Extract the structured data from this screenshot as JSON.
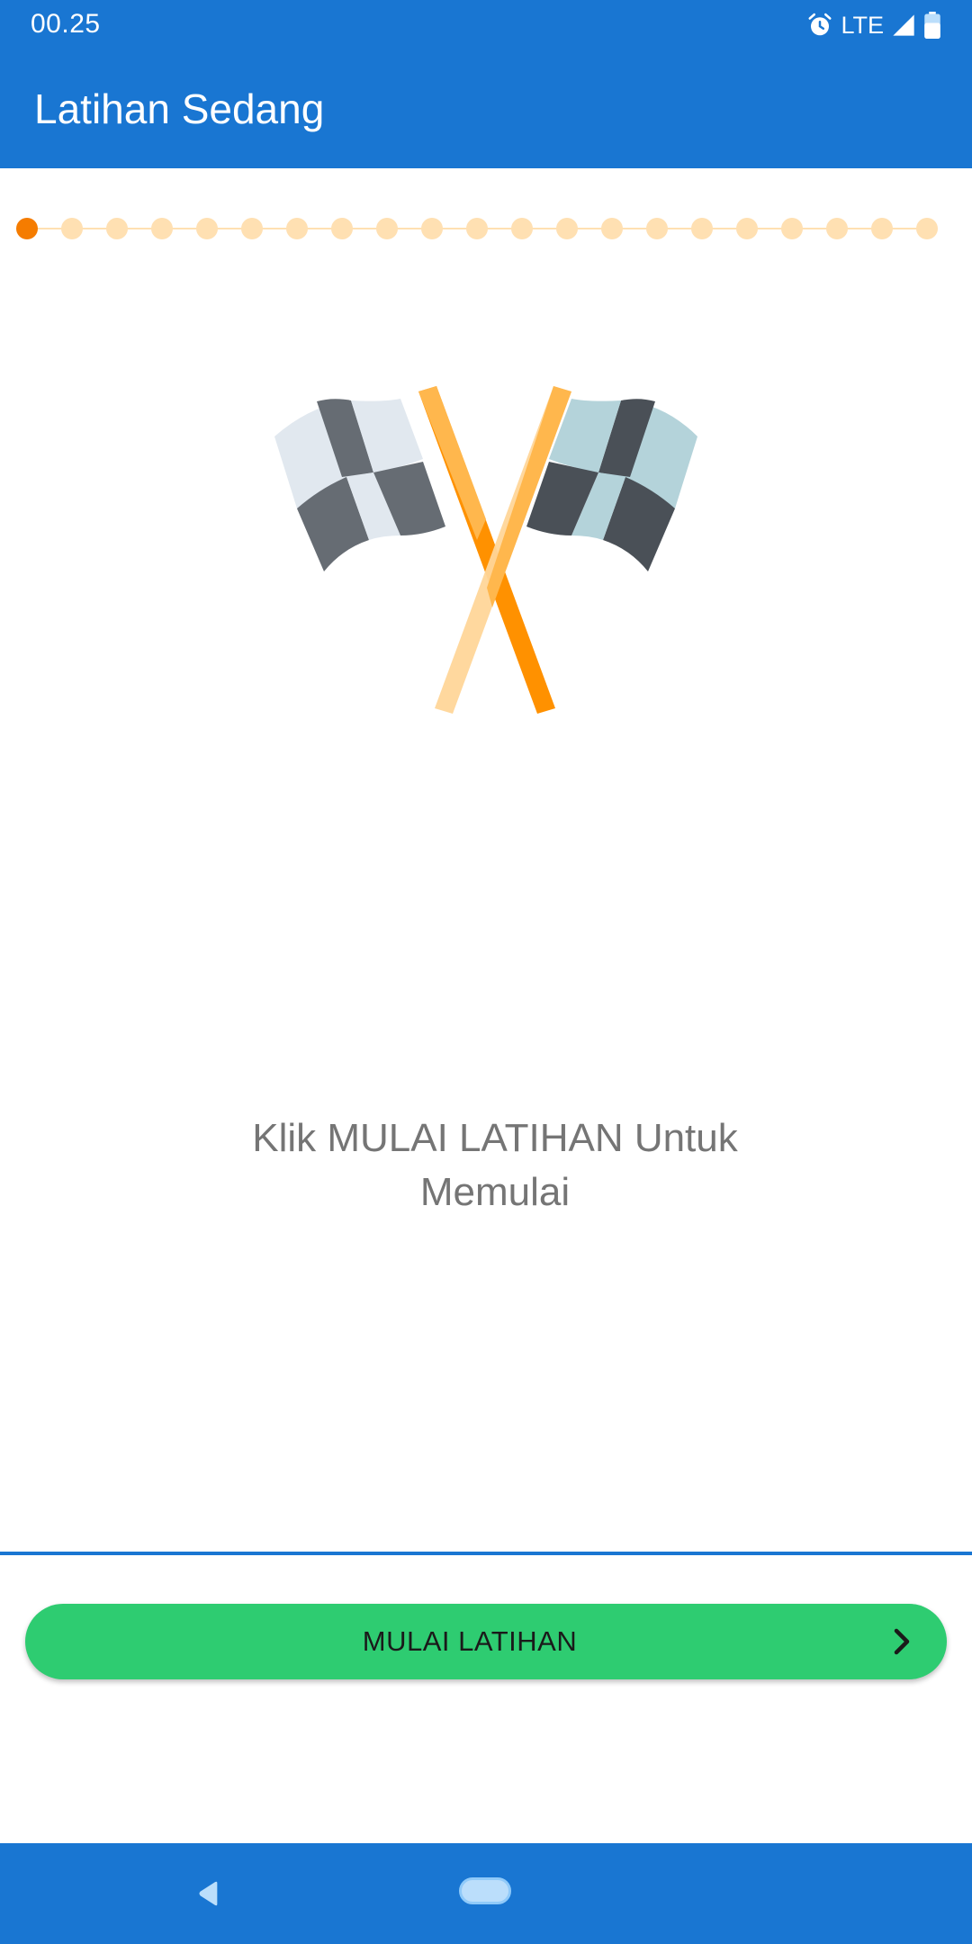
{
  "status_bar": {
    "time": "00.25",
    "network": "LTE",
    "icons": [
      "alarm-icon",
      "signal-icon",
      "battery-icon"
    ]
  },
  "app_bar": {
    "title": "Latihan Sedang"
  },
  "progress": {
    "total_steps": 21,
    "current_step": 1,
    "active_color": "#f57c00",
    "inactive_color": "#ffe0b2"
  },
  "illustration": {
    "icon": "checkered-flags-icon"
  },
  "instruction": {
    "line1": "Klik MULAI LATIHAN Untuk",
    "line2": "Memulai"
  },
  "start_button": {
    "label": "MULAI LATIHAN",
    "icon": "chevron-right-icon",
    "color": "#2ecc71"
  },
  "theme": {
    "primary": "#1976d2"
  }
}
